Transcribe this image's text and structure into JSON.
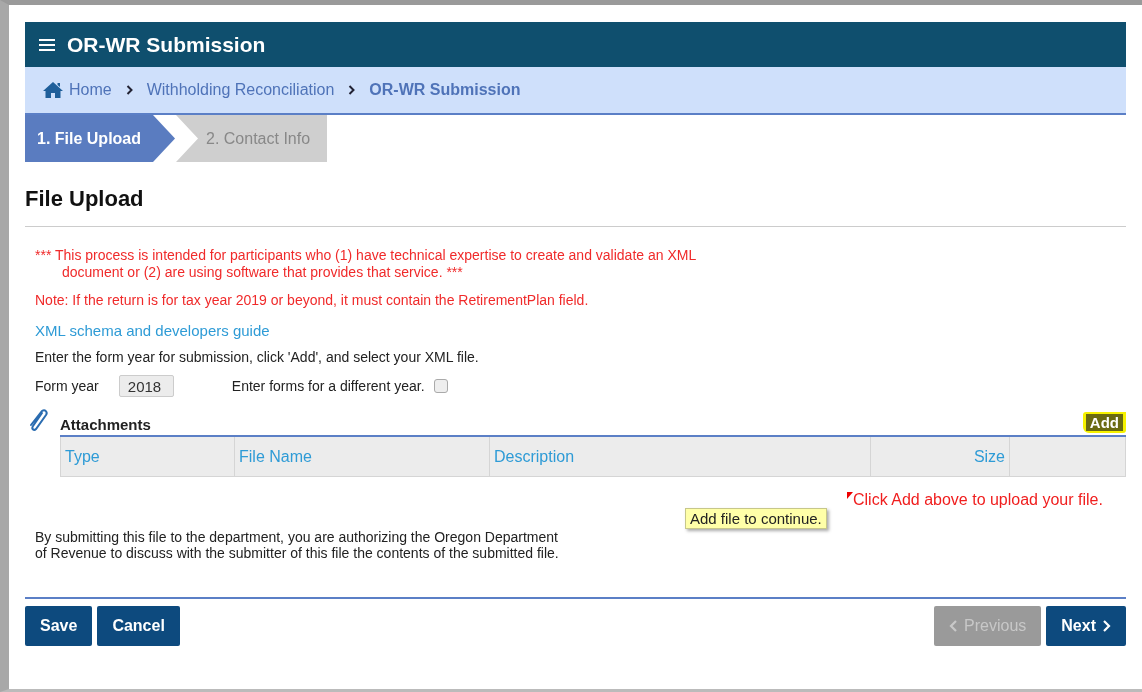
{
  "header": {
    "title": "OR-WR Submission"
  },
  "breadcrumb": [
    {
      "label": "Home",
      "current": false
    },
    {
      "label": "Withholding Reconciliation",
      "current": false
    },
    {
      "label": "OR-WR Submission",
      "current": true
    }
  ],
  "steps": [
    {
      "label": "1. File Upload",
      "selected": true
    },
    {
      "label": "2. Contact Info",
      "selected": false
    }
  ],
  "page_title": "File Upload",
  "warnings": [
    "*** This process is intended for participants who (1) have technical expertise to create and validate an XML document or (2) are using software that provides that service. ***",
    "Note: If the return is for tax year 2019 or beyond, it must contain the RetirementPlan field."
  ],
  "guide_link": "XML schema and developers guide",
  "instruction": "Enter the form year for submission, click 'Add', and select your XML file.",
  "form_year": {
    "label": "Form year",
    "value": "2018"
  },
  "different_year": {
    "label": "Enter forms for a different year.",
    "checked": false
  },
  "attachments": {
    "title": "Attachments",
    "add_button": "Add",
    "columns": [
      "Type",
      "File Name",
      "Description",
      "Size"
    ],
    "message": "Click Add above to upload your file.",
    "tooltip": "Add file to continue."
  },
  "disclaimer": "By submitting this file to the department, you are authorizing the Oregon Department of Revenue to discuss with the submitter of this file the contents of the submitted file.",
  "buttons_left": [
    {
      "label": "Save",
      "disabled": false
    },
    {
      "label": "Cancel",
      "disabled": false
    }
  ],
  "buttons_right": [
    {
      "label": "Previous",
      "kind": "prev",
      "disabled": true
    },
    {
      "label": "Next",
      "kind": "next",
      "disabled": false
    }
  ]
}
